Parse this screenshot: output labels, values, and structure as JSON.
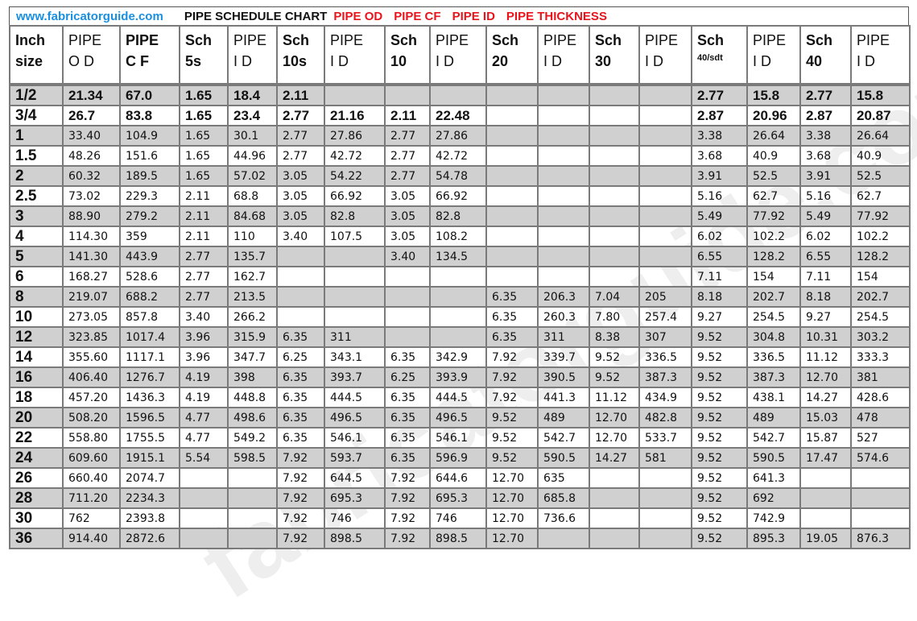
{
  "header": {
    "site": "www.fabricatorguide.com",
    "title": "PIPE SCHEDULE CHART",
    "legend": [
      "PIPE OD",
      "PIPE CF",
      "PIPE ID",
      "PIPE THICKNESS"
    ]
  },
  "watermark": "fabricatorguide.com",
  "colors": {
    "site": "#1a8fe0",
    "legend": "#e8141c",
    "row_shade": "#d0d0d0",
    "border": "#7a7a7a"
  },
  "columns": [
    {
      "l1": "Inch",
      "l2": "size"
    },
    {
      "l1": "PIPE",
      "l2": "O D"
    },
    {
      "l1": "PIPE",
      "l2": "C F"
    },
    {
      "l1": "Sch",
      "l2": "5s"
    },
    {
      "l1": "PIPE",
      "l2": "I D"
    },
    {
      "l1": "Sch",
      "l2": "10s"
    },
    {
      "l1": "PIPE",
      "l2": "I D"
    },
    {
      "l1": "Sch",
      "l2": "10"
    },
    {
      "l1": "PIPE",
      "l2": "I D"
    },
    {
      "l1": "Sch",
      "l2": "20"
    },
    {
      "l1": "PIPE",
      "l2": "I D"
    },
    {
      "l1": "Sch",
      "l2": "30"
    },
    {
      "l1": "PIPE",
      "l2": "I D"
    },
    {
      "l1": "Sch",
      "l2": "40/sdt"
    },
    {
      "l1": "PIPE",
      "l2": "I D"
    },
    {
      "l1": "Sch",
      "l2": "40"
    },
    {
      "l1": "PIPE",
      "l2": "I D"
    }
  ],
  "rows": [
    [
      "1/2",
      "21.34",
      "67.0",
      "1.65",
      "18.4",
      "2.11",
      "",
      "",
      "",
      "",
      "",
      "",
      "",
      "2.77",
      "15.8",
      "2.77",
      "15.8"
    ],
    [
      "3/4",
      "26.7",
      "83.8",
      "1.65",
      "23.4",
      "2.77",
      "21.16",
      "2.11",
      "22.48",
      "",
      "",
      "",
      "",
      "2.87",
      "20.96",
      "2.87",
      "20.87"
    ],
    [
      "1",
      "33.40",
      "104.9",
      "1.65",
      "30.1",
      "2.77",
      "27.86",
      "2.77",
      "27.86",
      "",
      "",
      "",
      "",
      "3.38",
      "26.64",
      "3.38",
      "26.64"
    ],
    [
      "1.5",
      "48.26",
      "151.6",
      "1.65",
      "44.96",
      "2.77",
      "42.72",
      "2.77",
      "42.72",
      "",
      "",
      "",
      "",
      "3.68",
      "40.9",
      "3.68",
      "40.9"
    ],
    [
      "2",
      "60.32",
      "189.5",
      "1.65",
      "57.02",
      "3.05",
      "54.22",
      "2.77",
      "54.78",
      "",
      "",
      "",
      "",
      "3.91",
      "52.5",
      "3.91",
      "52.5"
    ],
    [
      "2.5",
      "73.02",
      "229.3",
      "2.11",
      "68.8",
      "3.05",
      "66.92",
      "3.05",
      "66.92",
      "",
      "",
      "",
      "",
      "5.16",
      "62.7",
      "5.16",
      "62.7"
    ],
    [
      "3",
      "88.90",
      "279.2",
      "2.11",
      "84.68",
      "3.05",
      "82.8",
      "3.05",
      "82.8",
      "",
      "",
      "",
      "",
      "5.49",
      "77.92",
      "5.49",
      "77.92"
    ],
    [
      "4",
      "114.30",
      "359",
      "2.11",
      "110",
      "3.40",
      "107.5",
      "3.05",
      "108.2",
      "",
      "",
      "",
      "",
      "6.02",
      "102.2",
      "6.02",
      "102.2"
    ],
    [
      "5",
      "141.30",
      "443.9",
      "2.77",
      "135.7",
      "",
      "",
      "3.40",
      "134.5",
      "",
      "",
      "",
      "",
      "6.55",
      "128.2",
      "6.55",
      "128.2"
    ],
    [
      "6",
      "168.27",
      "528.6",
      "2.77",
      "162.7",
      "",
      "",
      "",
      "",
      "",
      "",
      "",
      "",
      "7.11",
      "154",
      "7.11",
      "154"
    ],
    [
      "8",
      "219.07",
      "688.2",
      "2.77",
      "213.5",
      "",
      "",
      "",
      "",
      "6.35",
      "206.3",
      "7.04",
      "205",
      "8.18",
      "202.7",
      "8.18",
      "202.7"
    ],
    [
      "10",
      "273.05",
      "857.8",
      "3.40",
      "266.2",
      "",
      "",
      "",
      "",
      "6.35",
      "260.3",
      "7.80",
      "257.4",
      "9.27",
      "254.5",
      "9.27",
      "254.5"
    ],
    [
      "12",
      "323.85",
      "1017.4",
      "3.96",
      "315.9",
      "6.35",
      "311",
      "",
      "",
      "6.35",
      "311",
      "8.38",
      "307",
      "9.52",
      "304.8",
      "10.31",
      "303.2"
    ],
    [
      "14",
      "355.60",
      "1117.1",
      "3.96",
      "347.7",
      "6.25",
      "343.1",
      "6.35",
      "342.9",
      "7.92",
      "339.7",
      "9.52",
      "336.5",
      "9.52",
      "336.5",
      "11.12",
      "333.3"
    ],
    [
      "16",
      "406.40",
      "1276.7",
      "4.19",
      "398",
      "6.35",
      "393.7",
      "6.25",
      "393.9",
      "7.92",
      "390.5",
      "9.52",
      "387.3",
      "9.52",
      "387.3",
      "12.70",
      "381"
    ],
    [
      "18",
      "457.20",
      "1436.3",
      "4.19",
      "448.8",
      "6.35",
      "444.5",
      "6.35",
      "444.5",
      "7.92",
      "441.3",
      "11.12",
      "434.9",
      "9.52",
      "438.1",
      "14.27",
      "428.6"
    ],
    [
      "20",
      "508.20",
      "1596.5",
      "4.77",
      "498.6",
      "6.35",
      "496.5",
      "6.35",
      "496.5",
      "9.52",
      "489",
      "12.70",
      "482.8",
      "9.52",
      "489",
      "15.03",
      "478"
    ],
    [
      "22",
      "558.80",
      "1755.5",
      "4.77",
      "549.2",
      "6.35",
      "546.1",
      "6.35",
      "546.1",
      "9.52",
      "542.7",
      "12.70",
      "533.7",
      "9.52",
      "542.7",
      "15.87",
      "527"
    ],
    [
      "24",
      "609.60",
      "1915.1",
      "5.54",
      "598.5",
      "7.92",
      "593.7",
      "6.35",
      "596.9",
      "9.52",
      "590.5",
      "14.27",
      "581",
      "9.52",
      "590.5",
      "17.47",
      "574.6"
    ],
    [
      "26",
      "660.40",
      "2074.7",
      "",
      "",
      "7.92",
      "644.5",
      "7.92",
      "644.6",
      "12.70",
      "635",
      "",
      "",
      "9.52",
      "641.3",
      "",
      ""
    ],
    [
      "28",
      "711.20",
      "2234.3",
      "",
      "",
      "7.92",
      "695.3",
      "7.92",
      "695.3",
      "12.70",
      "685.8",
      "",
      "",
      "9.52",
      "692",
      "",
      ""
    ],
    [
      "30",
      "762",
      "2393.8",
      "",
      "",
      "7.92",
      "746",
      "7.92",
      "746",
      "12.70",
      "736.6",
      "",
      "",
      "9.52",
      "742.9",
      "",
      ""
    ],
    [
      "36",
      "914.40",
      "2872.6",
      "",
      "",
      "7.92",
      "898.5",
      "7.92",
      "898.5",
      "12.70",
      "",
      "",
      "",
      "9.52",
      "895.3",
      "19.05",
      "876.3"
    ]
  ]
}
